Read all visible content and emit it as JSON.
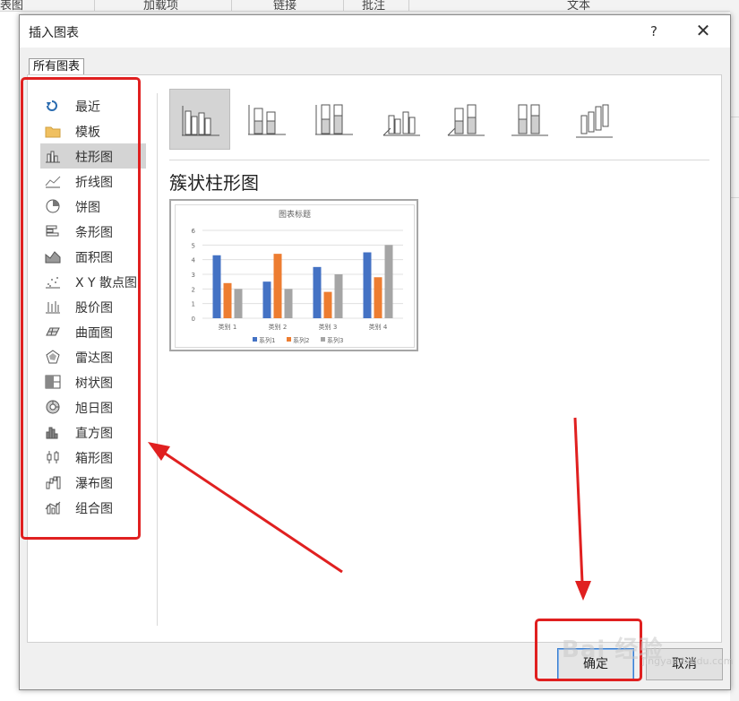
{
  "ribbon": {
    "items": [
      "表图",
      "加载项",
      "链接",
      "批注",
      "文本"
    ]
  },
  "dialog": {
    "title": "插入图表",
    "help": "?",
    "close": "✕",
    "tab": "所有图表",
    "categories": [
      {
        "label": "最近",
        "icon": "recent-icon"
      },
      {
        "label": "模板",
        "icon": "folder-icon"
      },
      {
        "label": "柱形图",
        "icon": "column-chart-icon"
      },
      {
        "label": "折线图",
        "icon": "line-chart-icon"
      },
      {
        "label": "饼图",
        "icon": "pie-chart-icon"
      },
      {
        "label": "条形图",
        "icon": "bar-chart-icon"
      },
      {
        "label": "面积图",
        "icon": "area-chart-icon"
      },
      {
        "label": "X Y 散点图",
        "icon": "scatter-chart-icon"
      },
      {
        "label": "股价图",
        "icon": "stock-chart-icon"
      },
      {
        "label": "曲面图",
        "icon": "surface-chart-icon"
      },
      {
        "label": "雷达图",
        "icon": "radar-chart-icon"
      },
      {
        "label": "树状图",
        "icon": "treemap-chart-icon"
      },
      {
        "label": "旭日图",
        "icon": "sunburst-chart-icon"
      },
      {
        "label": "直方图",
        "icon": "histogram-chart-icon"
      },
      {
        "label": "箱形图",
        "icon": "box-whisker-chart-icon"
      },
      {
        "label": "瀑布图",
        "icon": "waterfall-chart-icon"
      },
      {
        "label": "组合图",
        "icon": "combo-chart-icon"
      }
    ],
    "selected_category": "柱形图",
    "chart_type_title": "簇状柱形图",
    "buttons": {
      "ok": "确定",
      "cancel": "取消"
    }
  },
  "watermark": {
    "text": "Bai 经验",
    "sub": "jingyan.baidu.com"
  },
  "colors": {
    "series1": "#4472c4",
    "series2": "#ed7d31",
    "series3": "#a5a5a5",
    "annotation": "#e02020",
    "selection": "#d4d4d4"
  },
  "chart_data": {
    "type": "bar",
    "title": "图表标题",
    "categories": [
      "类别 1",
      "类别 2",
      "类别 3",
      "类别 4"
    ],
    "series": [
      {
        "name": "系列1",
        "values": [
          4.3,
          2.5,
          3.5,
          4.5
        ]
      },
      {
        "name": "系列2",
        "values": [
          2.4,
          4.4,
          1.8,
          2.8
        ]
      },
      {
        "name": "系列3",
        "values": [
          2,
          2,
          3,
          5
        ]
      }
    ],
    "ylim": [
      0,
      6
    ],
    "yticks": [
      "0",
      "1",
      "2",
      "3",
      "4",
      "5",
      "6"
    ],
    "legend": "bottom",
    "grid": true
  }
}
